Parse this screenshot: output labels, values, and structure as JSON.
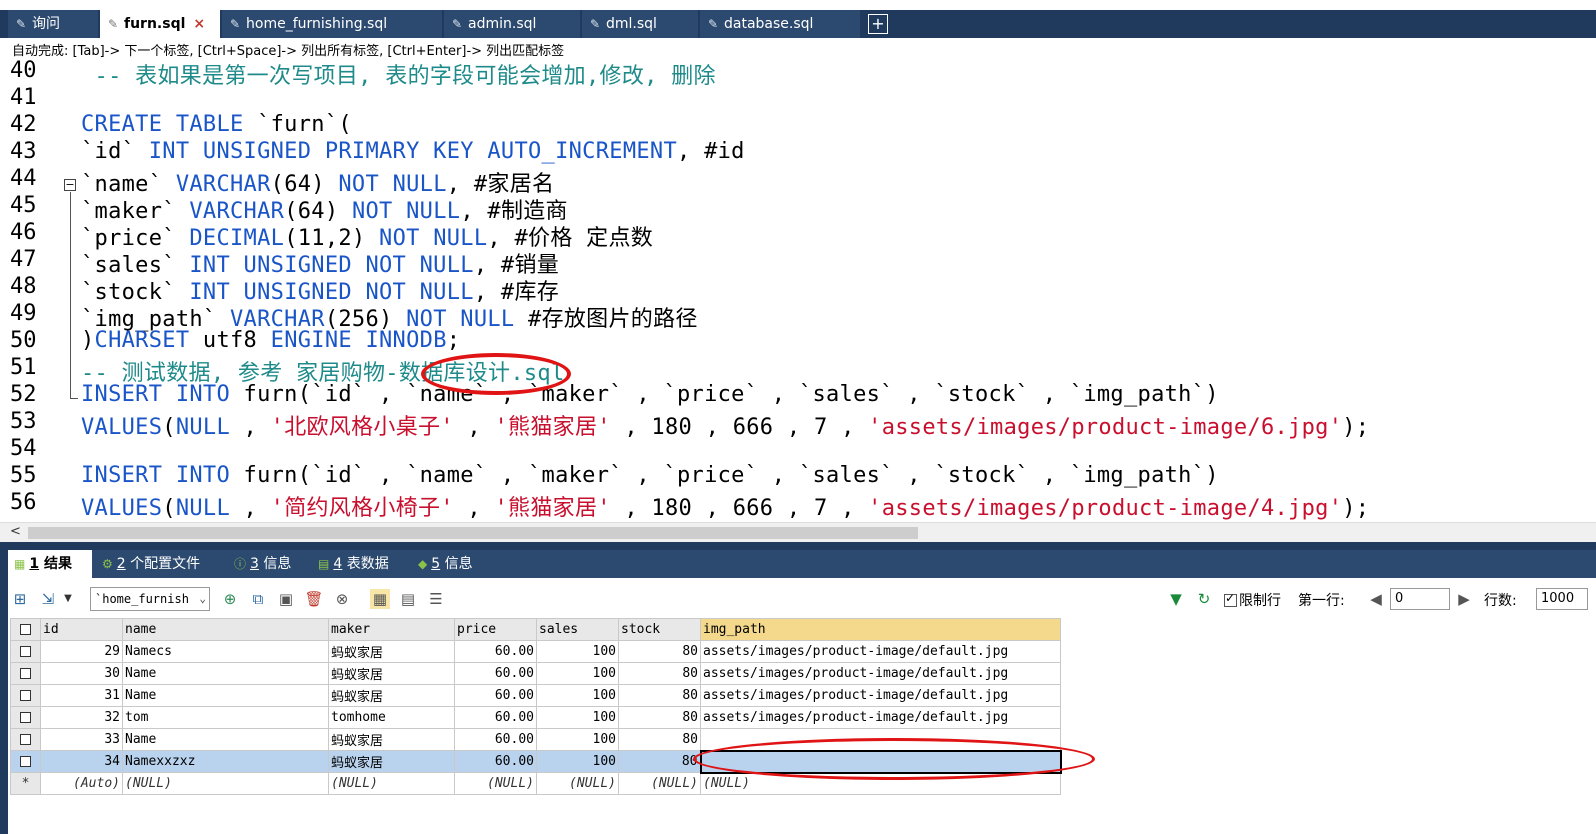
{
  "tabs": [
    {
      "label": "询问",
      "icon": "query-icon",
      "active": false
    },
    {
      "label": "furn.sql",
      "icon": "sql-file-icon",
      "active": true
    },
    {
      "label": "home_furnishing.sql",
      "icon": "sql-file-icon",
      "active": false
    },
    {
      "label": "admin.sql",
      "icon": "sql-file-icon",
      "active": false
    },
    {
      "label": "dml.sql",
      "icon": "sql-file-icon",
      "active": false
    },
    {
      "label": "database.sql",
      "icon": "sql-file-icon",
      "active": false
    }
  ],
  "autocomplete_hint": "自动完成:  [Tab]-> 下一个标签,  [Ctrl+Space]-> 列出所有标签,  [Ctrl+Enter]-> 列出匹配标签",
  "editor": {
    "line_numbers": [
      "40",
      "41",
      "42",
      "43",
      "44",
      "45",
      "46",
      "47",
      "48",
      "49",
      "50",
      "51",
      "52",
      "53",
      "54",
      "55",
      "56"
    ],
    "lines": {
      "l40": " -- 表如果是第一次写项目, 表的字段可能会增加,修改, 删除",
      "l42_kw": "CREATE TABLE",
      "l42_rest": " `furn`(",
      "l43_a": "`id` ",
      "l43_kw": "INT UNSIGNED PRIMARY KEY AUTO_INCREMENT",
      "l43_b": ", #id",
      "l44_a": "`name` ",
      "l44_kw": "VARCHAR",
      "l44_b": "(64) ",
      "l44_kw2": "NOT NULL",
      "l44_c": ", #家居名",
      "l45_a": "`maker` ",
      "l45_kw": "VARCHAR",
      "l45_b": "(64) ",
      "l45_kw2": "NOT NULL",
      "l45_c": ", #制造商",
      "l46_a": "`price` ",
      "l46_kw": "DECIMAL",
      "l46_b": "(11,2) ",
      "l46_kw2": "NOT NULL",
      "l46_c": ", #价格 定点数",
      "l47_a": "`sales` ",
      "l47_kw": "INT UNSIGNED NOT NULL",
      "l47_c": ", #销量",
      "l48_a": "`stock` ",
      "l48_kw": "INT UNSIGNED NOT NULL",
      "l48_c": ", #库存",
      "l49_a": "`img_path` ",
      "l49_kw": "VARCHAR",
      "l49_b": "(256) ",
      "l49_kw2": "NOT NULL",
      "l49_c": " #存放图片的路径",
      "l50_a": ")",
      "l50_kw": "CHARSET",
      "l50_b": " utf8 ",
      "l50_kw2": "ENGINE INNODB",
      "l50_c": ";",
      "l51": "-- 测试数据, 参考 家居购物-数据库设计.sql",
      "ins_kw": "INSERT INTO",
      "ins_rest": " furn(`id` , `name` , `maker` , `price` , `sales` , `stock` , `img_path`)",
      "val_kw": "VALUES",
      "val_a": "(",
      "val_null": "NULL",
      "val_sep": " , ",
      "l53_name": "'北欧风格小桌子'",
      "l53_maker": "'熊猫家居'",
      "val_nums": " , 180 , 666 , 7 , ",
      "l53_path": "'assets/images/product-image/6.jpg'",
      "val_end": ");",
      "l56_name": "'简约风格小椅子'",
      "l56_maker": "'熊猫家居'",
      "l56_path": "'assets/images/product-image/4.jpg'"
    }
  },
  "result_tabs": [
    {
      "num": "1",
      "label": " 结果",
      "active": true
    },
    {
      "num": "2",
      "label": " 个配置文件",
      "active": false
    },
    {
      "num": "3",
      "label": " 信息",
      "active": false
    },
    {
      "num": "4",
      "label": " 表数据",
      "active": false
    },
    {
      "num": "5",
      "label": " 信息",
      "active": false
    }
  ],
  "toolbar": {
    "table_select": "`home_furnish",
    "limit_label": "限制行",
    "limit_checked": true,
    "first_row_label": "第一行:",
    "first_row_value": "0",
    "rows_label": "行数:",
    "rows_value": "1000"
  },
  "grid": {
    "columns": [
      "id",
      "name",
      "maker",
      "price",
      "sales",
      "stock",
      "img_path"
    ],
    "rows": [
      [
        "29",
        "Namecs",
        "蚂蚁家居",
        "60.00",
        "100",
        "80",
        "assets/images/product-image/default.jpg"
      ],
      [
        "30",
        "Name",
        "蚂蚁家居",
        "60.00",
        "100",
        "80",
        "assets/images/product-image/default.jpg"
      ],
      [
        "31",
        "Name",
        "蚂蚁家居",
        "60.00",
        "100",
        "80",
        "assets/images/product-image/default.jpg"
      ],
      [
        "32",
        "tom",
        "tomhome",
        "60.00",
        "100",
        "80",
        "assets/images/product-image/default.jpg"
      ],
      [
        "33",
        "Name",
        "蚂蚁家居",
        "60.00",
        "100",
        "80",
        ""
      ],
      [
        "34",
        "Namexxzxz",
        "蚂蚁家居",
        "60.00",
        "100",
        "80",
        ""
      ]
    ],
    "new_row_marker": "*",
    "new_row": [
      "(Auto)",
      "(NULL)",
      "(NULL)",
      "(NULL)",
      "(NULL)",
      "(NULL)",
      "(NULL)"
    ]
  },
  "colors": {
    "keyword": "#1a55c8",
    "string": "#c8102e",
    "comment": "#1e8a8a",
    "annotation": "#e01414",
    "chrome": "#1f3a5c"
  }
}
